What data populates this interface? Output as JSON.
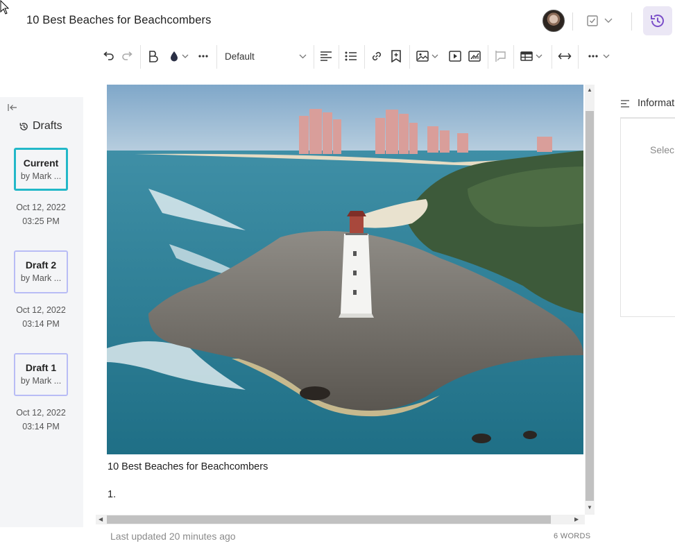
{
  "document": {
    "title": "10 Best Beaches for Beachcombers"
  },
  "header": {
    "avatar": "user-avatar",
    "check_menu_icon": "checkbox-icon",
    "history_icon": "history-icon",
    "accent_color": "#7b4fc9"
  },
  "toolbar": {
    "style_select_value": "Default",
    "items": [
      "undo-icon",
      "redo-icon",
      "bold-icon",
      "text-color-icon",
      "more-icon",
      "align-left-icon",
      "bullet-list-icon",
      "link-icon",
      "bookmark-icon",
      "image-icon",
      "video-icon",
      "chart-icon",
      "comment-icon",
      "table-icon",
      "expand-icon",
      "more-icon"
    ]
  },
  "drafts": {
    "title": "Drafts",
    "items": [
      {
        "name": "Current",
        "by": "by Mark ...",
        "date": "Oct 12, 2022",
        "time": "03:25 PM"
      },
      {
        "name": "Draft 2",
        "by": "by Mark ...",
        "date": "Oct 12, 2022",
        "time": "03:14 PM"
      },
      {
        "name": "Draft 1",
        "by": "by Mark ...",
        "date": "Oct 12, 2022",
        "time": "03:14 PM"
      }
    ],
    "current_border_color": "#22b8c8",
    "other_border_color": "#b8bcf5"
  },
  "editor": {
    "image_description": "lighthouse-beach-photo",
    "caption": "10 Best Beaches for Beachcombers",
    "list_marker": "1."
  },
  "footer": {
    "last_updated": "Last updated 20 minutes ago",
    "word_count": "6 WORDS"
  },
  "info_panel": {
    "title": "Informat",
    "select_text": "Selec"
  }
}
